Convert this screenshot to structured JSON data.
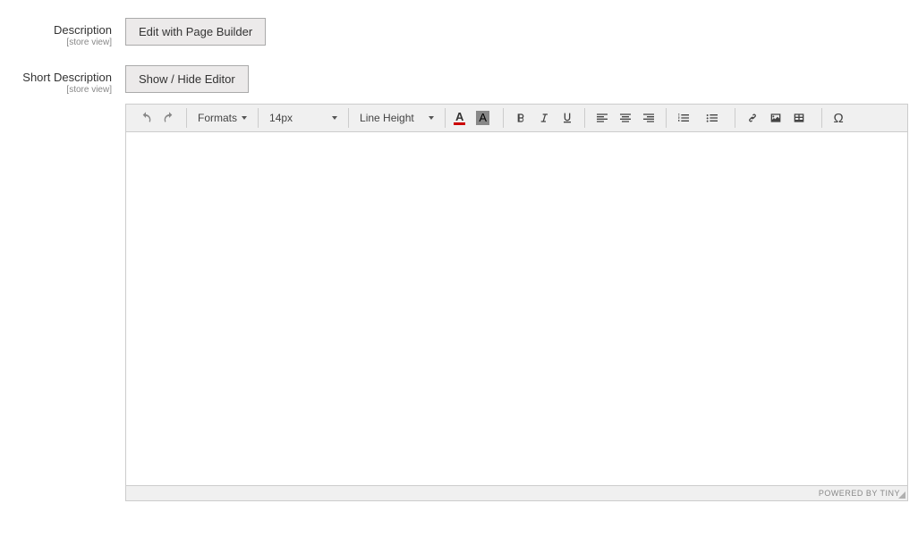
{
  "description": {
    "label": "Description",
    "scope": "[store view]",
    "button": "Edit with Page Builder"
  },
  "short_description": {
    "label": "Short Description",
    "scope": "[store view]",
    "button": "Show / Hide Editor"
  },
  "toolbar": {
    "formats": "Formats",
    "font_size": "14px",
    "line_height": "Line Height",
    "text_color_letter": "A",
    "bg_color_letter": "A"
  },
  "footer": {
    "powered": "POWERED BY TINY"
  }
}
